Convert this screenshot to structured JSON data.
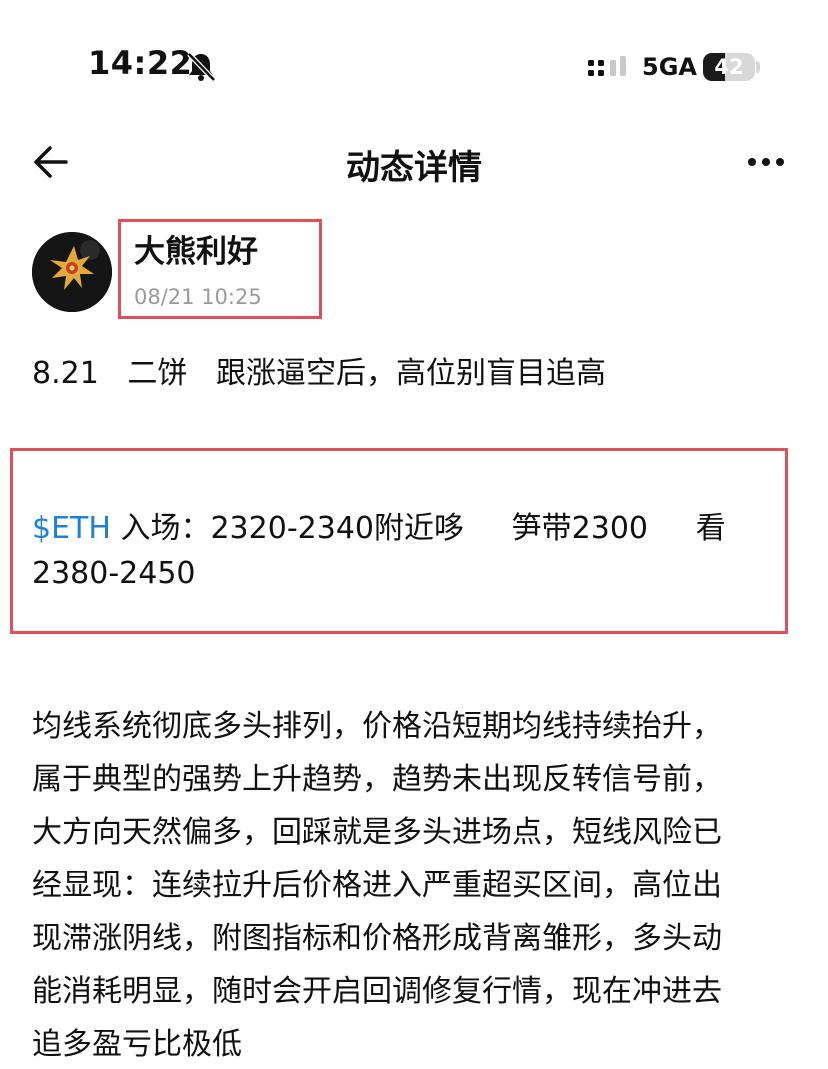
{
  "status_bar": {
    "time": "14:22",
    "network": "5GA",
    "battery": "42",
    "battery_level": 0.42,
    "icons": [
      "bell-muted-icon",
      "signal-icon",
      "battery-icon"
    ]
  },
  "nav": {
    "title": "动态详情",
    "icons": [
      "back-arrow-icon",
      "more-icon"
    ]
  },
  "post": {
    "author": "大熊利好",
    "time": "08/21 10:25",
    "headline": "8.21   二饼   跟涨逼空后，高位别盲目追高",
    "trade": {
      "tag": "$ETH",
      "line1_rest": " 入场：2320-2340附近哆     笋带2300     看",
      "line2": "2380-2450"
    },
    "analysis_lines": [
      "均线系统彻底多头排列，价格沿短期均线持续抬升，",
      "属于典型的强势上升趋势，趋势未出现反转信号前，",
      "大方向天然偏多，回踩就是多头进场点，短线风险已",
      "经显现：连续拉升后价格进入严重超买区间，高位出",
      "现滞涨阴线，附图指标和价格形成背离雏形，多头动",
      "能消耗明显，随时会开启回调修复行情，现在冲进去",
      "追多盈亏比极低"
    ]
  },
  "colors": {
    "highlight_border": "#e0505a",
    "link": "#1e80d8",
    "muted_text": "#9a9a9a"
  }
}
